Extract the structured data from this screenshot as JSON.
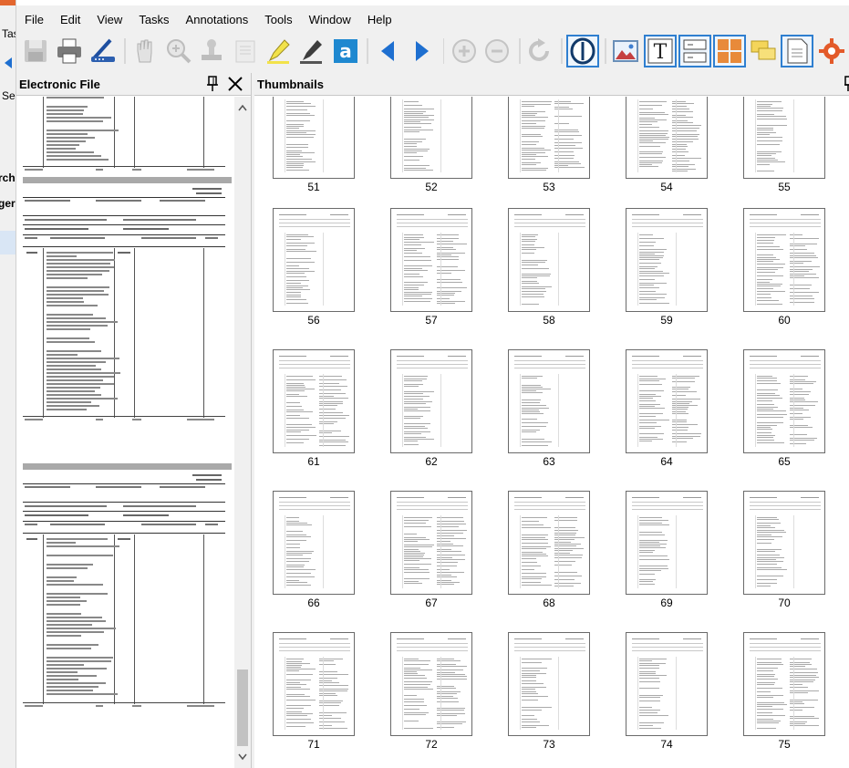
{
  "background_window": {
    "lines": [
      "Tas",
      "Sea",
      "rch",
      "ger"
    ]
  },
  "menu": [
    "File",
    "Edit",
    "View",
    "Tasks",
    "Annotations",
    "Tools",
    "Window",
    "Help"
  ],
  "toolbar": {
    "icons": [
      "save-icon",
      "print-icon",
      "scan-icon",
      "hand-icon",
      "zoom-icon",
      "stamp-icon",
      "note-icon",
      "highlighter-icon",
      "marker-icon",
      "text-a-icon",
      "prev-page-icon",
      "next-page-icon",
      "zoom-in-icon",
      "zoom-out-icon",
      "redo-icon",
      "ocr-icon",
      "image-icon",
      "text-box-icon",
      "form-icon",
      "layout-icon",
      "comments-icon",
      "page-icon",
      "settings-icon"
    ]
  },
  "left_panel": {
    "title": "Electronic File"
  },
  "thumbnails_panel": {
    "title": "Thumbnails",
    "pages": [
      "51",
      "52",
      "53",
      "54",
      "55",
      "56",
      "57",
      "58",
      "59",
      "60",
      "61",
      "62",
      "63",
      "64",
      "65",
      "66",
      "67",
      "68",
      "69",
      "70",
      "71",
      "72",
      "73",
      "74",
      "75"
    ]
  },
  "colors": {
    "accent": "#1e6fd0",
    "toolbar_box": "#2f7fd0",
    "page_separator": "#a9a9a9"
  }
}
